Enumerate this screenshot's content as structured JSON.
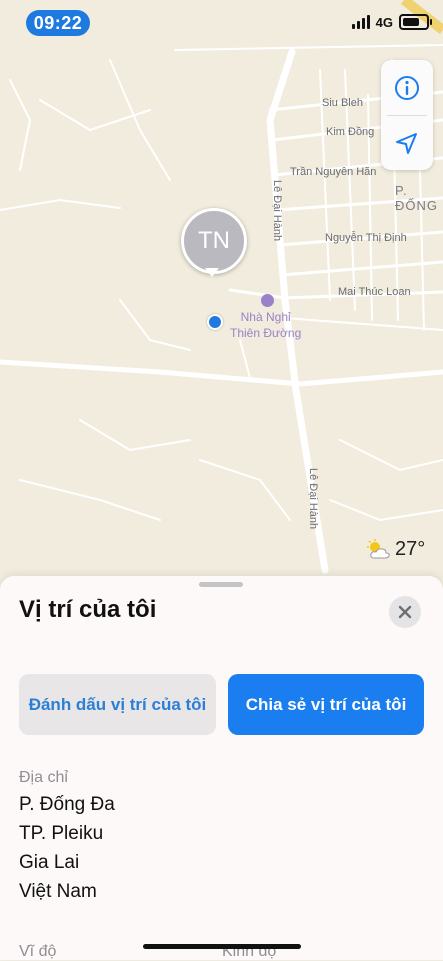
{
  "status_bar": {
    "time": "09:22",
    "network": "4G"
  },
  "map": {
    "streets": [
      "Siu Bleh",
      "Kim Đồng",
      "Trần Nguyên Hãn",
      "Lê Đại Hành",
      "Nguyễn Thị Định",
      "Mai Thúc Loan",
      "Lê Đại Hành"
    ],
    "district": "P. ĐỐNG",
    "avatar_initials": "TN",
    "poi": "Nhà Nghỉ\nThiên Đường",
    "weather_temp": "27°"
  },
  "sheet": {
    "title": "Vị trí của tôi",
    "mark_label": "Đánh dấu vị trí của tôi",
    "share_label": "Chia sẻ vị trí của tôi",
    "address_label": "Địa chỉ",
    "address_lines": [
      "P. Đống Đa",
      "TP. Pleiku",
      "Gia Lai",
      "Việt Nam"
    ],
    "latitude_label": "Vĩ độ",
    "longitude_label": "Kinh độ"
  },
  "colors": {
    "accent": "#1a7ef0",
    "map_bg": "#f1ecdd"
  }
}
